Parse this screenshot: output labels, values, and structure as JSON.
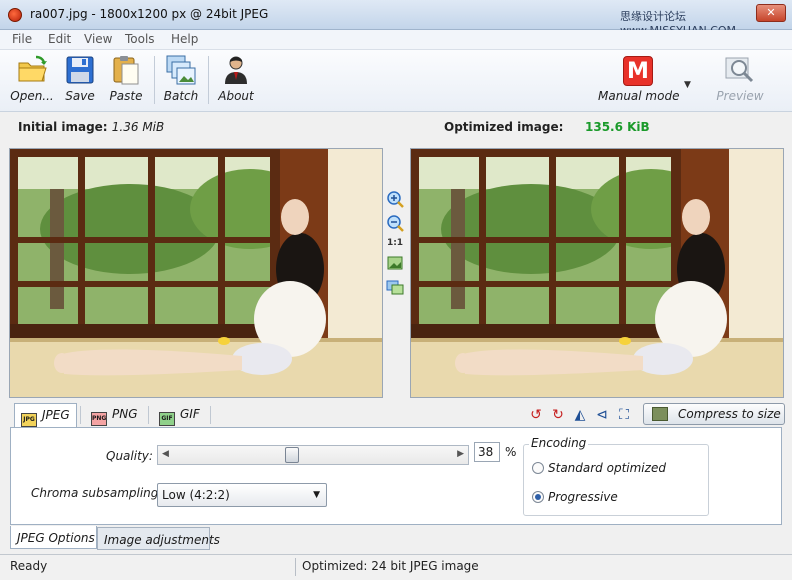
{
  "window": {
    "title": "ra007.jpg - 1800x1200 px @ 24bit JPEG",
    "watermark": "思缘设计论坛 www.MISSYUAN.COM",
    "close_glyph": "✕"
  },
  "menu": [
    "File",
    "Edit",
    "View",
    "Tools",
    "Help"
  ],
  "toolbar": {
    "open": "Open...",
    "save": "Save",
    "paste": "Paste",
    "batch": "Batch",
    "about": "About",
    "mode_letter": "M",
    "mode": "Manual mode",
    "preview": "Preview"
  },
  "images": {
    "initial_label": "Initial image:",
    "initial_size": "1.36 MiB",
    "optimized_label": "Optimized image:",
    "optimized_size": "135.6 KiB"
  },
  "zoom": {
    "actual_size": "1:1"
  },
  "formats": {
    "tabs": [
      {
        "label": "JPEG",
        "icon": "JPG"
      },
      {
        "label": "PNG",
        "icon": "PNG"
      },
      {
        "label": "GIF",
        "icon": "GIF"
      }
    ],
    "active": "JPEG",
    "compress_button": "Compress to size"
  },
  "jpeg_options": {
    "quality_label": "Quality:",
    "quality_value": "38",
    "quality_unit": "%",
    "quality_fraction": 0.38,
    "chroma_label": "Chroma subsampling:",
    "chroma_value": "Low (4:2:2)",
    "encoding_label": "Encoding",
    "encoding_options": [
      "Standard optimized",
      "Progressive"
    ],
    "encoding_selected": "Progressive"
  },
  "bottom_tabs": [
    "JPEG Options",
    "Image adjustments"
  ],
  "status": {
    "left": "Ready",
    "right": "Optimized: 24 bit JPEG image"
  },
  "colors": {
    "optimized_size": "#1a9a2a",
    "manual_mode": "#e8322a",
    "radio_selected": "#2e5fa8"
  }
}
